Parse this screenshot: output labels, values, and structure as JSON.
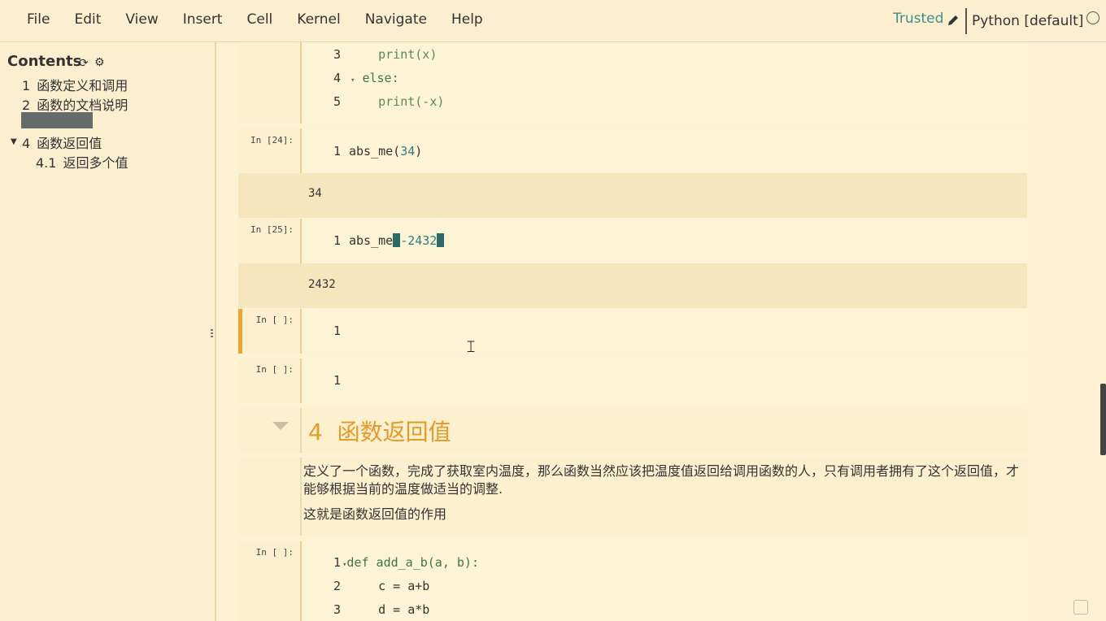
{
  "menu": {
    "items": [
      "File",
      "Edit",
      "View",
      "Insert",
      "Cell",
      "Kernel",
      "Navigate",
      "Help"
    ],
    "trusted_label": "Trusted",
    "kernel_name": "Python [default]"
  },
  "sidebar": {
    "title": "Contents",
    "items": [
      {
        "num": "1",
        "label": "函数定义和调用"
      },
      {
        "num": "2",
        "label": "函数的文档说明"
      },
      {
        "num": "4",
        "label": "函数返回值"
      },
      {
        "num": "4.1",
        "label": "返回多个值"
      }
    ]
  },
  "cells": {
    "top": {
      "lines": [
        {
          "n": "3",
          "code": "print(x)"
        },
        {
          "n": "4",
          "code": "else:"
        },
        {
          "n": "5",
          "code": "print(-x)"
        }
      ]
    },
    "c24": {
      "prompt": "In [24]:",
      "n": "1",
      "code_fn": "abs_me(",
      "code_arg": "34",
      "code_end": ")",
      "output": "34"
    },
    "c25": {
      "prompt": "In [25]:",
      "n": "1",
      "code_fn": "abs_me",
      "code_arg": "-2432",
      "output": "2432"
    },
    "empty1": {
      "prompt": "In [ ]:",
      "n": "1"
    },
    "empty2": {
      "prompt": "In [ ]:",
      "n": "1"
    },
    "heading": {
      "num": "4",
      "text": "函数返回值"
    },
    "markdown": {
      "p1": "定义了一个函数，完成了获取室内温度，那么函数当然应该把温度值返回给调用函数的人，只有调用者拥有了这个返回值，才能够根据当前的温度做适当的调整.",
      "p2": "这就是函数返回值的作用"
    },
    "last": {
      "prompt": "In [ ]:",
      "lines": [
        {
          "n": "1",
          "kw": "def",
          "code": "add_a_b(a, b):"
        },
        {
          "n": "2",
          "code": "c = a+b"
        },
        {
          "n": "3",
          "code": "d = a*b"
        }
      ]
    }
  }
}
